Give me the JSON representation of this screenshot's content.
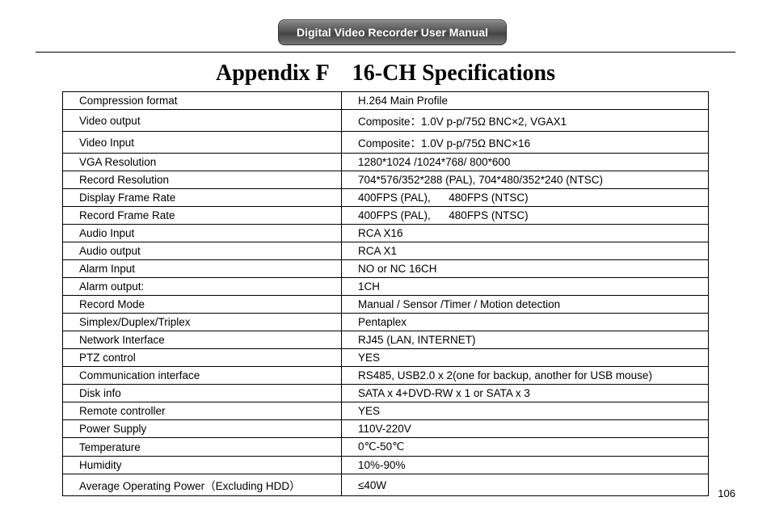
{
  "header": {
    "badge": "Digital Video Recorder User Manual"
  },
  "title": {
    "left": "Appendix F",
    "right": "16-CH Specifications"
  },
  "rows": [
    {
      "k": "Compression format",
      "v": "H.264 Main Profile"
    },
    {
      "k": "Video output",
      "v": "Composite：1.0V p-p/75Ω BNC×2, VGAX1"
    },
    {
      "k": "Video Input",
      "v": "Composite：1.0V p-p/75Ω BNC×16"
    },
    {
      "k": "VGA Resolution",
      "v": "1280*1024 /1024*768/ 800*600"
    },
    {
      "k": "Record Resolution",
      "v": "704*576/352*288 (PAL), 704*480/352*240 (NTSC)"
    },
    {
      "k": "Display Frame Rate",
      "v": "400FPS (PAL),      480FPS (NTSC)"
    },
    {
      "k": "Record Frame Rate",
      "v": "400FPS (PAL),      480FPS (NTSC)"
    },
    {
      "k": "Audio Input",
      "v": "RCA X16"
    },
    {
      "k": "Audio output",
      "v": "RCA X1"
    },
    {
      "k": "Alarm Input",
      "v": "NO or NC 16CH"
    },
    {
      "k": "Alarm output:",
      "v": "1CH"
    },
    {
      "k": "Record Mode",
      "v": "Manual / Sensor /Timer / Motion detection"
    },
    {
      "k": "Simplex/Duplex/Triplex",
      "v": "Pentaplex"
    },
    {
      "k": "Network Interface",
      "v": "RJ45 (LAN, INTERNET)"
    },
    {
      "k": "PTZ control",
      "v": "YES"
    },
    {
      "k": "Communication interface",
      "v": "RS485, USB2.0 x 2(one for backup, another for USB mouse)"
    },
    {
      "k": "Disk info",
      "v": "SATA x 4+DVD-RW x 1 or SATA x 3"
    },
    {
      "k": "Remote controller",
      "v": "YES"
    },
    {
      "k": "Power Supply",
      "v": "110V-220V"
    },
    {
      "k": "Temperature",
      "v": "0℃-50℃"
    },
    {
      "k": "Humidity",
      "v": "10%-90%"
    },
    {
      "k": "Average Operating Power（Excluding HDD）",
      "v": "≤40W"
    }
  ],
  "page_number": "106"
}
